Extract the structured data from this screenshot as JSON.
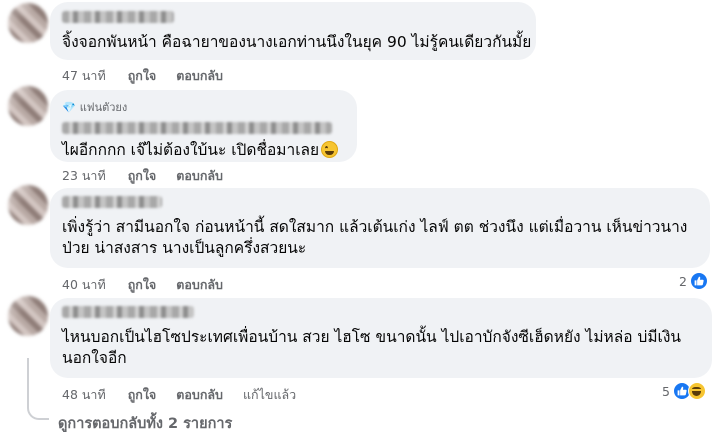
{
  "comments": [
    {
      "badge": "",
      "text_lines": [
        "จิ้งจอกพันหน้า คือฉายาของนางเอกท่านนึงในยุค 90 ไม่รู้คนเดียวกันมั้ย"
      ],
      "emoji": "",
      "time": "47 นาที",
      "like": "ถูกใจ",
      "reply": "ตอบกลับ",
      "edited": "",
      "reaction_count": ""
    },
    {
      "badge": "แฟนตัวยง",
      "text_lines": [
        "ไผอีกกกก เจ๊ไม่ต้องใบ้นะ เปิดชื่อมาเลย"
      ],
      "emoji": "grinning-sweat-emoji",
      "time": "23 นาที",
      "like": "ถูกใจ",
      "reply": "ตอบกลับ",
      "edited": "",
      "reaction_count": ""
    },
    {
      "badge": "",
      "text_lines": [
        "เพิ่งรู้ว่า สามีนอกใจ ก่อนหน้านี้ สดใสมาก แล้วเต้นเก่ง ไลฟ์ ตต ช่วงนึง แต่เมื่อวาน เห็นข่าวนาง",
        "ป่วย น่าสงสาร นางเป็นลูกครึ่งสวยนะ"
      ],
      "emoji": "",
      "time": "40 นาที",
      "like": "ถูกใจ",
      "reply": "ตอบกลับ",
      "edited": "",
      "reaction_count": "2"
    },
    {
      "badge": "",
      "text_lines": [
        "ไหนบอกเป็นไฮโซประเทศเพื่อนบ้าน สวย ไฮโซ ขนาดนั้น ไปเอาบักจังซีเฮ็ดหยัง ไม่หล่อ บ่มีเงิน",
        "นอกใจอีก"
      ],
      "emoji": "",
      "time": "48 นาที",
      "like": "ถูกใจ",
      "reply": "ตอบกลับ",
      "edited": "แก้ไขแล้ว",
      "reaction_count": "5"
    }
  ],
  "view_replies": "ดูการตอบกลับทั้ง 2 รายการ",
  "colors": {
    "bubble": "#f0f2f5",
    "muted": "#65676b",
    "like_blue": "#1877f2"
  }
}
